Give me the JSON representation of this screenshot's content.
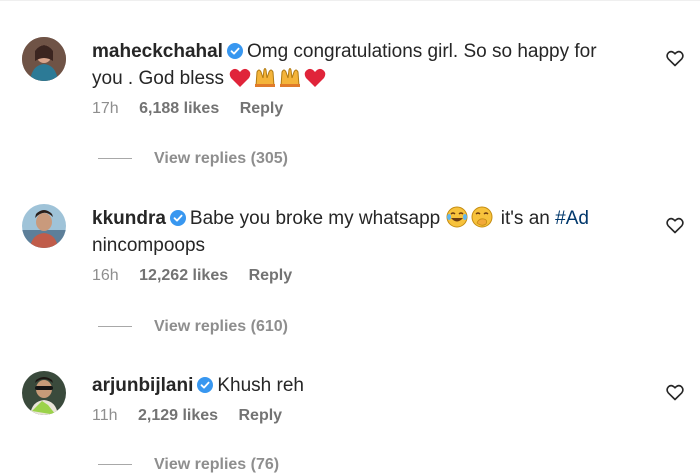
{
  "comments": [
    {
      "username": "maheckchahal",
      "text1": "Omg congratulations girl. So so happy for",
      "text2": "you . God bless",
      "time": "17h",
      "likes": "6,188 likes",
      "reply_label": "Reply",
      "view_replies": "View replies (305)",
      "emojis": [
        "red-heart",
        "praising-hands",
        "praising-hands",
        "red-heart"
      ]
    },
    {
      "username": "kkundra",
      "text1": "Babe you broke my whatsapp",
      "text1b": "it's an",
      "hashtag": "#Ad",
      "text2": "nincompoops",
      "time": "16h",
      "likes": "12,262 likes",
      "reply_label": "Reply",
      "view_replies": "View replies (610)",
      "emojis": [
        "tears-of-joy",
        "smiling-hand-over-mouth"
      ]
    },
    {
      "username": "arjunbijlani",
      "text1": "Khush reh",
      "time": "11h",
      "likes": "2,129 likes",
      "reply_label": "Reply",
      "view_replies": "View replies (76)"
    }
  ],
  "colors": {
    "verified": "#3897f0",
    "hashtag": "#00376b",
    "muted": "#8e8e8e"
  }
}
